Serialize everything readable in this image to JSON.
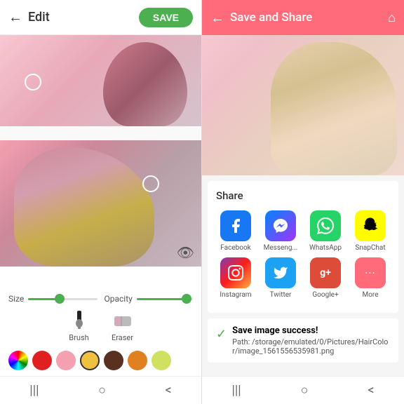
{
  "left": {
    "header": {
      "back_label": "←",
      "title": "Edit",
      "save_btn": "SAVE"
    },
    "sliders": {
      "size_label": "Size",
      "opacity_label": "Opacity"
    },
    "tools": {
      "brush_label": "Brush",
      "eraser_label": "Eraser"
    },
    "nav": {
      "menu": "|||",
      "home": "○",
      "back": "<"
    }
  },
  "right": {
    "header": {
      "back_label": "←",
      "title": "Save and Share",
      "home_icon": "⌂"
    },
    "share": {
      "title": "Share",
      "items": [
        {
          "id": "facebook",
          "label": "Facebook",
          "icon": "f",
          "bg": "facebook-bg"
        },
        {
          "id": "messenger",
          "label": "Messeng...",
          "icon": "m",
          "bg": "messenger-bg"
        },
        {
          "id": "whatsapp",
          "label": "WhatsApp",
          "icon": "w",
          "bg": "whatsapp-bg"
        },
        {
          "id": "snapchat",
          "label": "SnapChat",
          "icon": "👻",
          "bg": "snapchat-bg"
        },
        {
          "id": "instagram",
          "label": "Instagram",
          "icon": "📷",
          "bg": "instagram-bg"
        },
        {
          "id": "twitter",
          "label": "Twitter",
          "icon": "t",
          "bg": "twitter-bg"
        },
        {
          "id": "googleplus",
          "label": "Google+",
          "icon": "g+",
          "bg": "googleplus-bg"
        },
        {
          "id": "more",
          "label": "More",
          "icon": "···",
          "bg": "more-bg"
        }
      ]
    },
    "success": {
      "title": "Save image success!",
      "path": "Path: /storage/emulated/0/Pictures/HairColor/image_1561556535981.png"
    },
    "nav": {
      "menu": "|||",
      "home": "○",
      "back": "<"
    }
  }
}
